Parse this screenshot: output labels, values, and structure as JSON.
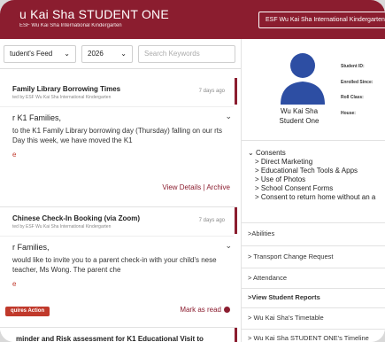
{
  "header": {
    "app_title": "u Kai Sha STUDENT ONE",
    "subtitle": "ESF Wu Kai Sha International Kindergarten",
    "school_button": "ESF Wu Kai Sha International Kindergarten"
  },
  "filters": {
    "feed_select": "tudent's Feed",
    "year_select": "2026",
    "search_placeholder": "Search Keywords"
  },
  "feed": {
    "cards": [
      {
        "title": "Family Library Borrowing Times",
        "posted_by": "ted by ESF Wu Kai Sha International Kindergarten",
        "date": "7 days ago",
        "greeting": "r K1 Families,",
        "body": "to the K1 Family Library borrowing day (Thursday) falling on our rts Day this week, we have moved the K1",
        "more": "e",
        "actions": "View Details  | Archive"
      },
      {
        "title": "Chinese Check-In Booking (via Zoom)",
        "posted_by": "ted by ESF Wu Kai Sha International Kindergarten",
        "date": "7 days ago",
        "greeting": "r Families,",
        "body": "would like to invite you to a parent check-in with your child's nese teacher, Ms Wong. The parent che",
        "more": "e",
        "badge": "quires Action",
        "mark_read": "Mark as read"
      },
      {
        "title": "minder and Risk assessment for K1 Educational Visit to"
      }
    ]
  },
  "profile": {
    "name_line1": "Wu Kai Sha",
    "name_line2": "Student One",
    "fields": [
      "Student ID:",
      "Enrolled Since:",
      "Roll Class:",
      "House:"
    ]
  },
  "consents": {
    "heading": "Consents",
    "items": [
      "Direct Marketing",
      "Educational Tech Tools & Apps",
      "Use of Photos",
      "School Consent Forms",
      "Consent to return home without an a"
    ]
  },
  "sidebar_links": {
    "abilities": ">Abilities",
    "transport": "> Transport Change Request",
    "attendance": "> Attendance",
    "reports": ">View Student Reports",
    "timetable": "> Wu Kai Sha's Timetable",
    "timeline": "> Wu Kai Sha STUDENT ONE's Timeline"
  },
  "colors": {
    "brand": "#8b1d2f",
    "alert": "#c0392b"
  }
}
